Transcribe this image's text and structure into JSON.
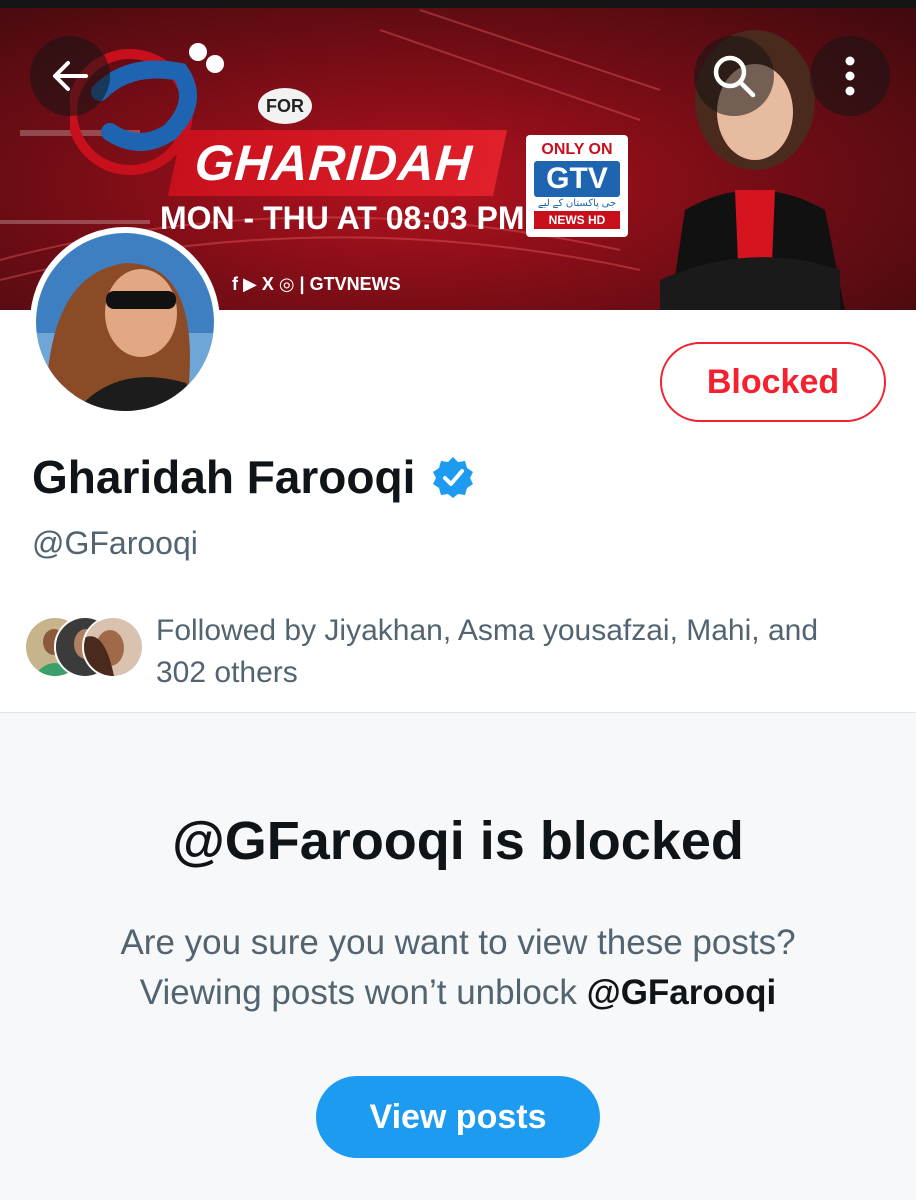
{
  "banner": {
    "for_label": "FOR",
    "show_title": "GHARIDAH",
    "show_time": "MON - THU  AT 08:03 PM",
    "social_handle": "f ▶ X ◎ | GTVNEWS",
    "channel_only_on": "ONLY ON",
    "channel_logo": "GTV",
    "channel_sub": "جی پاکستان کے لیے",
    "channel_news": "NEWS HD"
  },
  "header": {
    "back_icon": "arrow-left-icon",
    "search_icon": "search-icon",
    "more_icon": "more-vertical-icon"
  },
  "profile": {
    "display_name": "Gharidah Farooqi",
    "handle": "@GFarooqi",
    "verified": true,
    "action_button_label": "Blocked",
    "followed_by_text": "Followed by Jiyakhan, Asma yousafzai, Mahi, and 302 others"
  },
  "blocked_notice": {
    "title": "@GFarooqi is blocked",
    "message_line1": "Are you sure you want to view these posts?",
    "message_line2_prefix": "Viewing posts won’t unblock ",
    "message_line2_handle": "@GFarooqi",
    "view_button_label": "View posts"
  },
  "colors": {
    "blocked_red": "#f4212e",
    "primary_blue": "#1d9bf0",
    "secondary_text": "#536471",
    "banner_red": "#b3121f"
  }
}
